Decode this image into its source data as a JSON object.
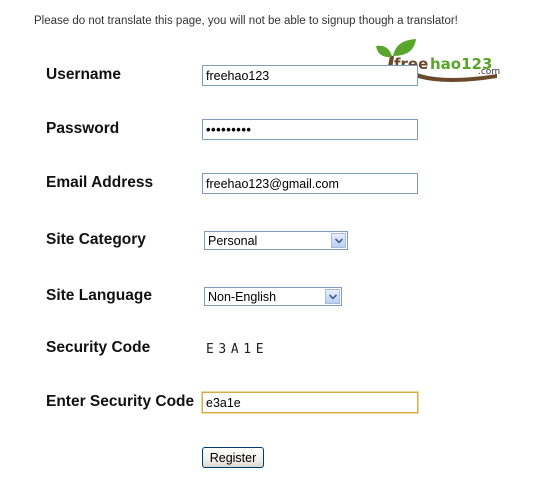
{
  "notice": "Please do not translate this page, you will not be able to signup though a translator!",
  "logo": {
    "brand": "freehao123",
    "text_main": "freehao123",
    "text_suffix": ".com",
    "accent": "#5aa52c",
    "trunk_color": "#6b4a2b"
  },
  "form": {
    "username": {
      "label": "Username",
      "value": "freehao123"
    },
    "password": {
      "label": "Password",
      "masked_value": "•••••••••"
    },
    "email": {
      "label": "Email Address",
      "value": "freehao123@gmail.com"
    },
    "site_category": {
      "label": "Site Category",
      "selected": "Personal",
      "icon": "chevron-down-icon"
    },
    "site_language": {
      "label": "Site Language",
      "selected": "Non-English",
      "icon": "chevron-down-icon"
    },
    "security_code": {
      "label": "Security Code",
      "code": "E3A1E"
    },
    "enter_security_code": {
      "label": "Enter Security Code",
      "value": "e3a1e"
    },
    "register_label": "Register"
  },
  "colors": {
    "input_border": "#7f9db9",
    "focus_border": "#d6a94a",
    "button_border": "#003c74"
  }
}
